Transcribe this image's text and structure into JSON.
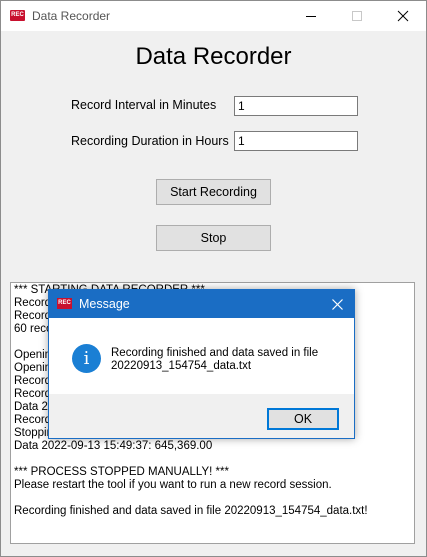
{
  "window": {
    "title": "Data Recorder",
    "icon_text": "REC"
  },
  "main": {
    "heading": "Data Recorder",
    "interval_label": "Record Interval in Minutes",
    "interval_value": "1",
    "duration_label": "Recording Duration in Hours",
    "duration_value": "1",
    "start_button": "Start Recording",
    "stop_button": "Stop"
  },
  "log": {
    "lines": [
      "*** STARTING DATA RECORDER ***",
      "Record",
      "Record",
      "60 reco",
      "",
      "Openin",
      "Openin",
      "Record",
      "Record",
      "Data 20",
      "Record",
      "Stoppir",
      "Data 2022-09-13 15:49:37: 645,369.00",
      "",
      "*** PROCESS STOPPED MANUALLY! ***",
      "Please restart the tool if you want to run a new record session.",
      "",
      "Recording finished and data saved in file 20220913_154754_data.txt!"
    ]
  },
  "dialog": {
    "title": "Message",
    "icon_text": "REC",
    "message_line1": "Recording finished and data saved in file",
    "message_line2": "20220913_154754_data.txt",
    "ok_button": "OK"
  },
  "colors": {
    "dialog_titlebar": "#1a6dc4",
    "app_icon": "#c8102e",
    "info_icon": "#1a7fd4"
  }
}
